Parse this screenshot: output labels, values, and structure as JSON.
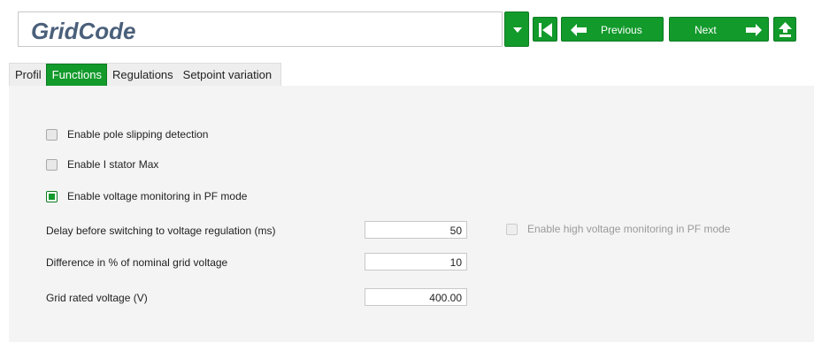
{
  "header": {
    "title": "GridCode",
    "previous_label": "Previous",
    "next_label": "Next"
  },
  "tabs": [
    {
      "label": "Profil",
      "active": false
    },
    {
      "label": "Functions",
      "active": true
    },
    {
      "label": "Regulations",
      "active": false
    },
    {
      "label": "Setpoint variation",
      "active": false
    }
  ],
  "checkboxes": {
    "pole_slipping": {
      "label": "Enable pole slipping detection",
      "checked": false
    },
    "i_stator_max": {
      "label": "Enable I stator Max",
      "checked": false
    },
    "voltage_monitoring": {
      "label": "Enable voltage monitoring in PF mode",
      "checked": true
    },
    "high_voltage_monitoring": {
      "label": "Enable high voltage monitoring in PF mode",
      "checked": false,
      "disabled": true
    }
  },
  "fields": {
    "delay": {
      "label": "Delay before switching to voltage regulation (ms)",
      "value": "50"
    },
    "difference": {
      "label": "Difference in % of nominal grid voltage",
      "value": "10"
    },
    "rated_voltage": {
      "label": "Grid rated voltage (V)",
      "value": "400.00"
    }
  },
  "colors": {
    "accent": "#129a2b",
    "title": "#4a5f7a",
    "panel_bg": "#f4f4f4"
  },
  "icons": [
    "chevron-down-icon",
    "first-page-icon",
    "arrow-left-icon",
    "arrow-right-icon",
    "upload-icon"
  ]
}
